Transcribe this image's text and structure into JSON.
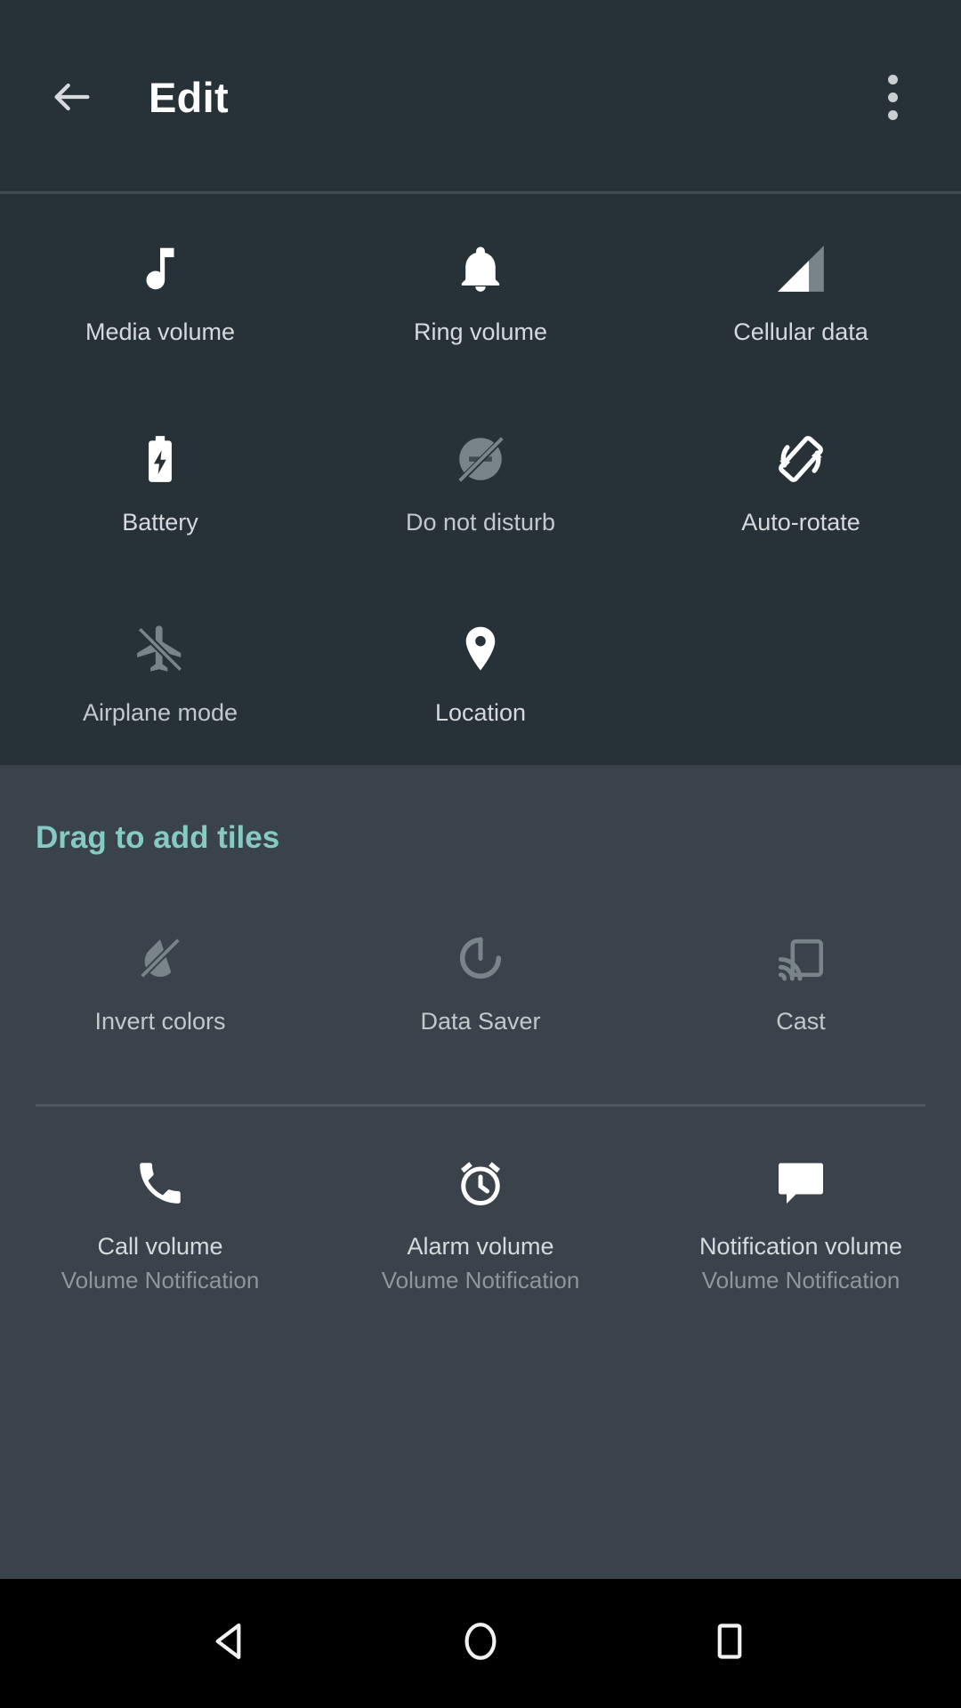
{
  "header": {
    "title": "Edit",
    "back_icon": "arrow-back-icon",
    "overflow_icon": "more-vert-icon"
  },
  "colors": {
    "panel_current_bg": "#263238",
    "panel_add_bg": "#3a434b",
    "accent_teal": "#85cac3",
    "icon_active": "#ffffff",
    "icon_dim": "#78838a",
    "label": "#d6dadd",
    "sublabel": "#8f979d",
    "navbar_bg": "#000000"
  },
  "current_tiles": {
    "rows": [
      [
        {
          "label": "Media volume",
          "icon": "music-note-icon",
          "state": "active"
        },
        {
          "label": "Ring volume",
          "icon": "bell-icon",
          "state": "active"
        },
        {
          "label": "Cellular data",
          "icon": "signal-bar-icon",
          "state": "active"
        }
      ],
      [
        {
          "label": "Battery",
          "icon": "battery-charging-icon",
          "state": "active"
        },
        {
          "label": "Do not disturb",
          "icon": "do-not-disturb-off-icon",
          "state": "dim"
        },
        {
          "label": "Auto-rotate",
          "icon": "screen-rotation-icon",
          "state": "active"
        }
      ],
      [
        {
          "label": "Airplane mode",
          "icon": "airplane-off-icon",
          "state": "dim"
        },
        {
          "label": "Location",
          "icon": "location-pin-icon",
          "state": "active"
        },
        {
          "label": "",
          "icon": "",
          "state": "empty"
        }
      ]
    ]
  },
  "add_section": {
    "title": "Drag to add tiles",
    "row1": [
      {
        "label": "Invert colors",
        "icon": "invert-colors-off-icon",
        "state": "dim"
      },
      {
        "label": "Data Saver",
        "icon": "data-saver-icon",
        "state": "dim"
      },
      {
        "label": "Cast",
        "icon": "cast-icon",
        "state": "dim"
      }
    ],
    "row2": [
      {
        "label": "Call volume",
        "sublabel": "Volume Notification",
        "icon": "phone-icon",
        "state": "active"
      },
      {
        "label": "Alarm volume",
        "sublabel": "Volume Notification",
        "icon": "alarm-clock-icon",
        "state": "active"
      },
      {
        "label": "Notification volume",
        "sublabel": "Volume Notification",
        "icon": "chat-bubble-icon",
        "state": "active"
      }
    ]
  },
  "navbar": {
    "back_label": "back-nav",
    "home_label": "home-nav",
    "recents_label": "recents-nav"
  }
}
